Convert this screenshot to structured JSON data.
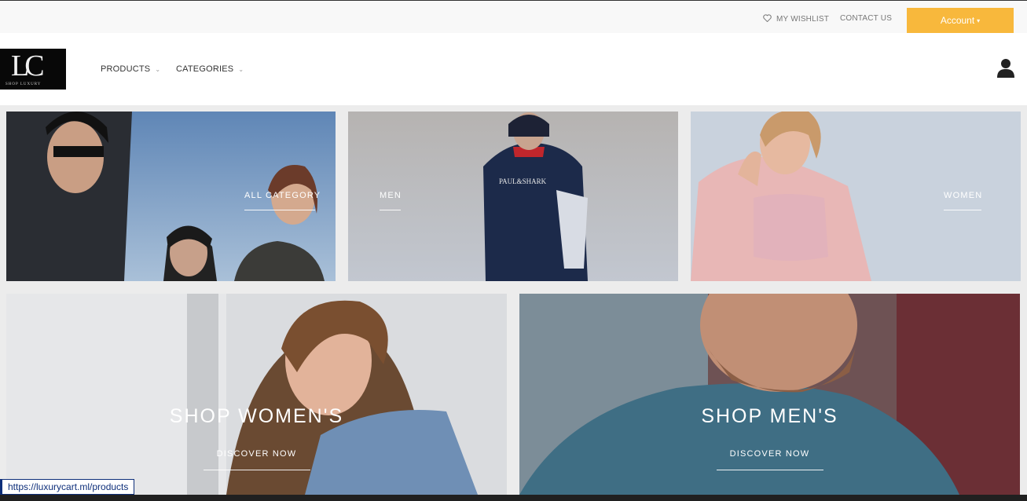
{
  "topbar": {
    "wishlist_label": "MY WISHLIST",
    "contact_label": "CONTACT US",
    "account_label": "Account",
    "accent": "#f8b83c"
  },
  "header": {
    "logo_mark": "LC",
    "logo_tagline": "SHOP LUXURY",
    "nav": [
      {
        "label": "PRODUCTS"
      },
      {
        "label": "CATEGORIES"
      }
    ]
  },
  "tiles": [
    {
      "label": "ALL CATEGORY"
    },
    {
      "label": "MEN"
    },
    {
      "label": "WOMEN"
    }
  ],
  "banners": [
    {
      "title": "SHOP WOMEN'S",
      "cta": "DISCOVER NOW"
    },
    {
      "title": "SHOP MEN'S",
      "cta": "DISCOVER NOW"
    }
  ],
  "status": {
    "url": "https://luxurycart.ml/products"
  }
}
